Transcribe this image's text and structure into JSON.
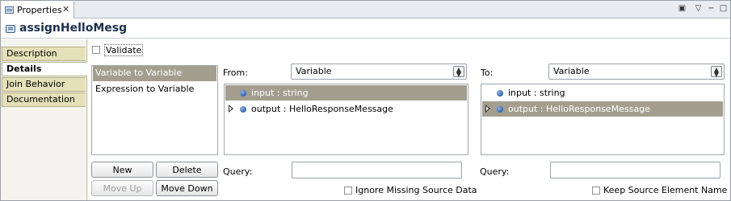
{
  "tab": {
    "title": "Properties",
    "close": "✕"
  },
  "toolbar": {
    "pin": "▣",
    "menu": "▽",
    "minimize": "−",
    "maximize": "□"
  },
  "header": {
    "title": "assignHelloMesg"
  },
  "sections": [
    {
      "label": "Description",
      "active": false
    },
    {
      "label": "Details",
      "active": true
    },
    {
      "label": "Join Behavior",
      "active": false
    },
    {
      "label": "Documentation",
      "active": false
    }
  ],
  "validate": {
    "label": "Validate",
    "checked": false
  },
  "kinds": [
    {
      "label": "Variable to Variable",
      "selected": true
    },
    {
      "label": "Expression to Variable",
      "selected": false
    }
  ],
  "buttons": {
    "new": "New",
    "delete": "Delete",
    "move_up": "Move Up",
    "move_down": "Move Down"
  },
  "from": {
    "label": "From:",
    "type": "Variable",
    "items": [
      {
        "label": "input : string",
        "selected": true,
        "expandable": false
      },
      {
        "label": "output : HelloResponseMessage",
        "selected": false,
        "expandable": true
      }
    ],
    "query_label": "Query:",
    "query_value": "",
    "option_label": "Ignore Missing Source Data",
    "option_checked": false
  },
  "to": {
    "label": "To:",
    "type": "Variable",
    "items": [
      {
        "label": "input : string",
        "selected": false,
        "expandable": false
      },
      {
        "label": "output : HelloResponseMessage",
        "selected": true,
        "expandable": true
      }
    ],
    "query_label": "Query:",
    "query_value": "",
    "option_label": "Keep Source Element Name",
    "option_checked": false
  },
  "icons": {
    "arrow": "⌃⌄"
  }
}
